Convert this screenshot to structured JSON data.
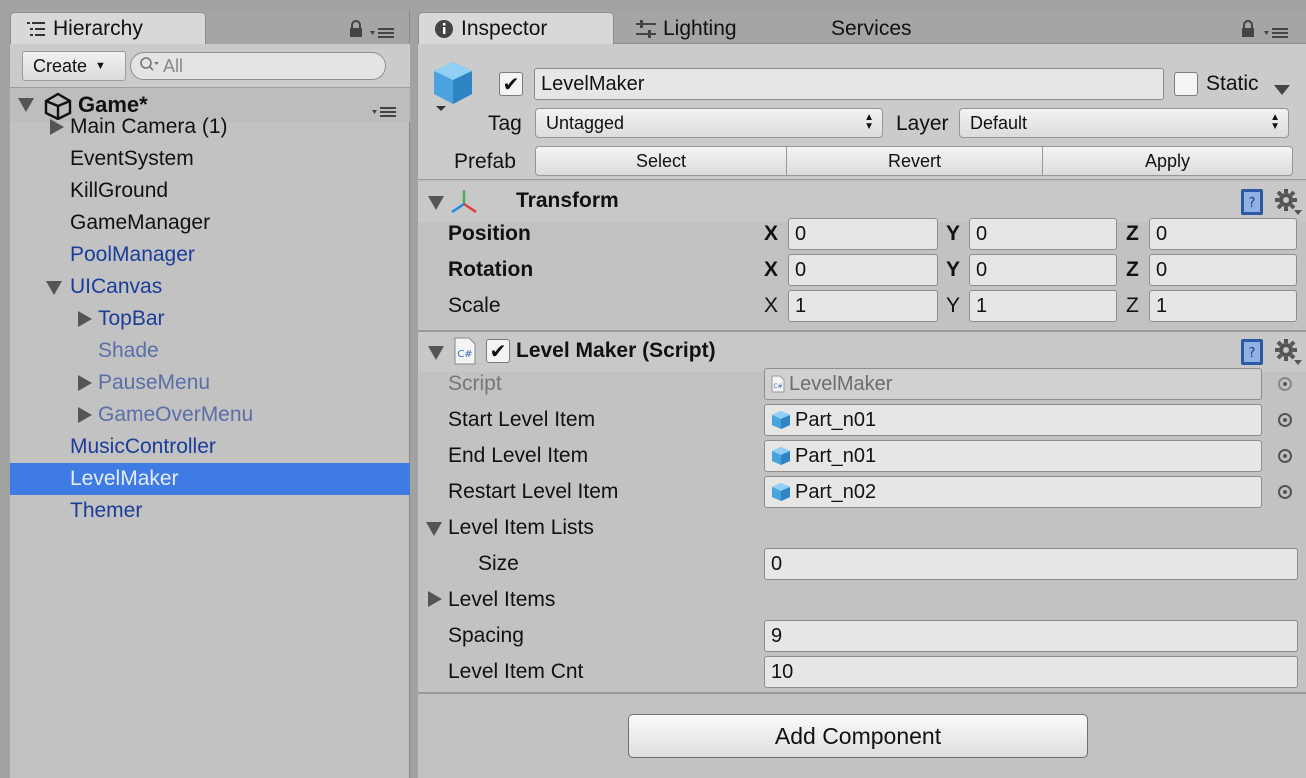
{
  "hierarchy": {
    "tab_label": "Hierarchy",
    "create_label": "Create",
    "search_placeholder": "All",
    "scene_name": "Game*",
    "items": [
      {
        "label": "Main Camera (1)"
      },
      {
        "label": "EventSystem"
      },
      {
        "label": "KillGround"
      },
      {
        "label": "GameManager"
      },
      {
        "label": "PoolManager"
      },
      {
        "label": "UICanvas"
      },
      {
        "label": "TopBar"
      },
      {
        "label": "Shade"
      },
      {
        "label": "PauseMenu"
      },
      {
        "label": "GameOverMenu"
      },
      {
        "label": "MusicController"
      },
      {
        "label": "LevelMaker"
      },
      {
        "label": "Themer"
      }
    ]
  },
  "inspector": {
    "tabs": [
      {
        "label": "Inspector"
      },
      {
        "label": "Lighting"
      },
      {
        "label": "Services"
      }
    ],
    "object_name": "LevelMaker",
    "static_label": "Static",
    "tag_label": "Tag",
    "tag_value": "Untagged",
    "layer_label": "Layer",
    "layer_value": "Default",
    "prefab_label": "Prefab",
    "prefab_buttons": [
      "Select",
      "Revert",
      "Apply"
    ],
    "transform": {
      "title": "Transform",
      "rows": [
        {
          "label": "Position",
          "x": "0",
          "y": "0",
          "z": "0"
        },
        {
          "label": "Rotation",
          "x": "0",
          "y": "0",
          "z": "0"
        },
        {
          "label": "Scale",
          "x": "1",
          "y": "1",
          "z": "1"
        }
      ],
      "axis": [
        "X",
        "Y",
        "Z"
      ]
    },
    "script": {
      "title": "Level Maker (Script)",
      "script_label": "Script",
      "script_value": "LevelMaker",
      "start_label": "Start Level Item",
      "start_value": "Part_n01",
      "end_label": "End Level Item",
      "end_value": "Part_n01",
      "restart_label": "Restart Level Item",
      "restart_value": "Part_n02",
      "lists_label": "Level Item Lists",
      "size_label": "Size",
      "size_value": "0",
      "items_label": "Level Items",
      "spacing_label": "Spacing",
      "spacing_value": "9",
      "cnt_label": "Level Item Cnt",
      "cnt_value": "10"
    },
    "add_component": "Add Component"
  },
  "colors": {
    "selection": "#3e7ce4",
    "blue_text": "#1b3d9a"
  }
}
